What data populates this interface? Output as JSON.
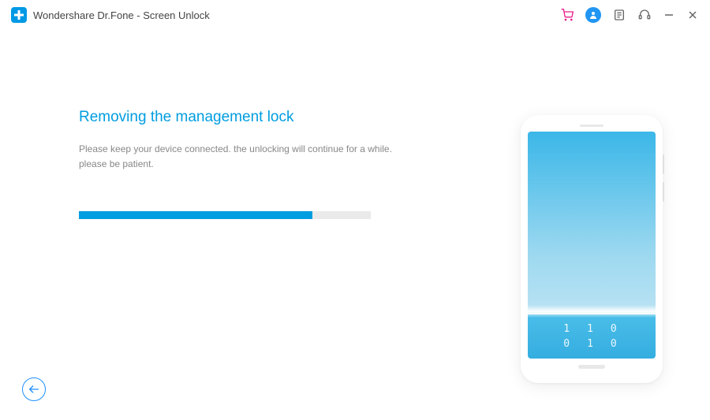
{
  "app": {
    "title": "Wondershare Dr.Fone - Screen Unlock"
  },
  "main": {
    "heading": "Removing the management lock",
    "subtext": "Please keep your device connected. the unlocking will continue for a while. please be patient.",
    "progress_percent": 80
  },
  "phone": {
    "code_row1": "110",
    "code_row2": "010"
  },
  "colors": {
    "accent": "#009de0"
  }
}
